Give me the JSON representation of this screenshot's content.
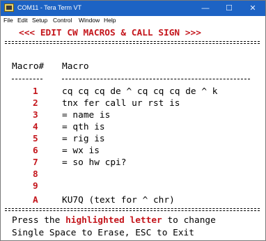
{
  "window": {
    "title": "COM11 - Tera Term VT",
    "controls": [
      "—",
      "☐",
      "✕"
    ]
  },
  "menu": [
    "File",
    "Edit",
    "Setup",
    "Control",
    "Window",
    "Help"
  ],
  "terminal": {
    "header": "<<< EDIT CW MACROS & CALL SIGN >>>",
    "col_key": "Macro#",
    "col_macro": "Macro",
    "macros": [
      {
        "key": "1",
        "text": "cq cq cq de ^ cq cq cq de ^ k"
      },
      {
        "key": "2",
        "text": "tnx fer call ur rst is"
      },
      {
        "key": "3",
        "text": "= name is"
      },
      {
        "key": "4",
        "text": "= qth is"
      },
      {
        "key": "5",
        "text": "= rig is"
      },
      {
        "key": "6",
        "text": "= wx is"
      },
      {
        "key": "7",
        "text": "= so hw cpi?"
      },
      {
        "key": "8",
        "text": ""
      },
      {
        "key": "9",
        "text": ""
      },
      {
        "key": "A",
        "text": "KU7Q (text for ^ chr)"
      }
    ],
    "footer_press": "Press the",
    "footer_highlight": "highlighted letter",
    "footer_change": "to change",
    "footer_line2": "Single Space to Erase, ESC to Exit"
  },
  "colors": {
    "accent_red": "#c4161c",
    "titlebar_blue": "#1d63c4"
  }
}
